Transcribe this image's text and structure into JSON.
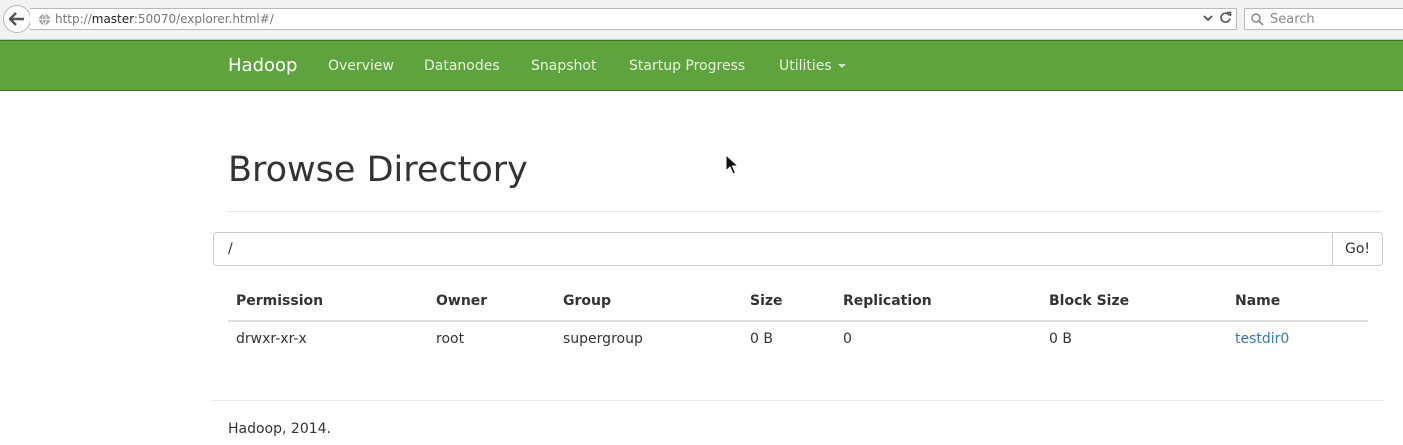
{
  "browser": {
    "url_prefix": "http://",
    "url_host": "master",
    "url_rest": ":50070/explorer.html#/",
    "search_placeholder": "Search"
  },
  "navbar": {
    "brand": "Hadoop",
    "items": [
      {
        "label": "Overview"
      },
      {
        "label": "Datanodes"
      },
      {
        "label": "Snapshot"
      },
      {
        "label": "Startup Progress"
      },
      {
        "label": "Utilities"
      }
    ]
  },
  "page": {
    "title": "Browse Directory",
    "path_value": "/",
    "go_label": "Go!"
  },
  "table": {
    "headers": [
      "Permission",
      "Owner",
      "Group",
      "Size",
      "Replication",
      "Block Size",
      "Name"
    ],
    "rows": [
      [
        "drwxr-xr-x",
        "root",
        "supergroup",
        "0 B",
        "0",
        "0 B",
        "testdir0"
      ]
    ]
  },
  "footer": {
    "text": "Hadoop, 2014."
  },
  "colors": {
    "navbar": "#5fa33e",
    "link": "#337ab7"
  }
}
